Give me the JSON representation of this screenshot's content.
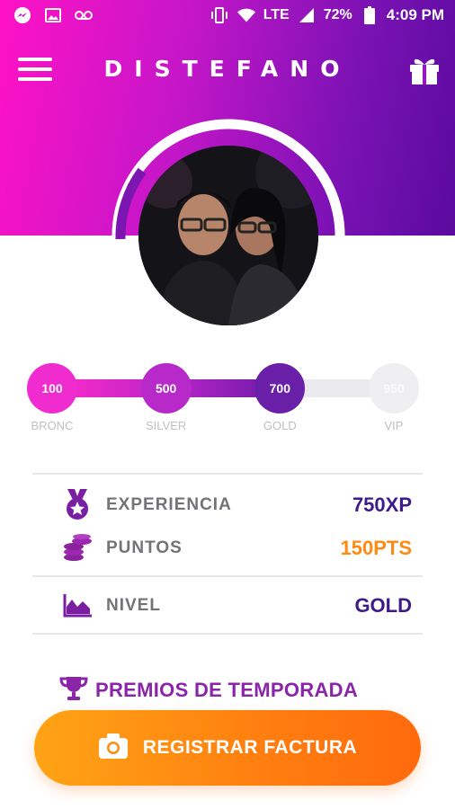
{
  "status_bar": {
    "battery": "72%",
    "network": "LTE",
    "time": "4:09 PM"
  },
  "header": {
    "brand": "DISTEFANO"
  },
  "levels": {
    "progress_points": 750,
    "nodes": [
      {
        "value": "100",
        "label": "BRONC",
        "color": "#f02bd0",
        "reached": true
      },
      {
        "value": "500",
        "label": "SILVER",
        "color": "#b72ac9",
        "reached": true
      },
      {
        "value": "700",
        "label": "GOLD",
        "color": "#6a1fa8",
        "reached": true
      },
      {
        "value": "950",
        "label": "VIP",
        "color": "#efeff2",
        "reached": false
      }
    ]
  },
  "stats": {
    "experiencia": {
      "label": "EXPERIENCIA",
      "value": "750XP",
      "color": "#3f1a8a"
    },
    "puntos": {
      "label": "PUNTOS",
      "value": "150PTS",
      "color": "#ff8a12"
    },
    "nivel": {
      "label": "NIVEL",
      "value": "GOLD",
      "color": "#3f1a8a"
    }
  },
  "premios": {
    "label": "PREMIOS DE TEMPORADA"
  },
  "register_button": {
    "label": "REGISTRAR FACTURA"
  },
  "colors": {
    "gradient_start": "#ff12c6",
    "gradient_end": "#5a0a9e",
    "accent_orange": "#ff8a12",
    "accent_purple": "#8a24a8"
  }
}
